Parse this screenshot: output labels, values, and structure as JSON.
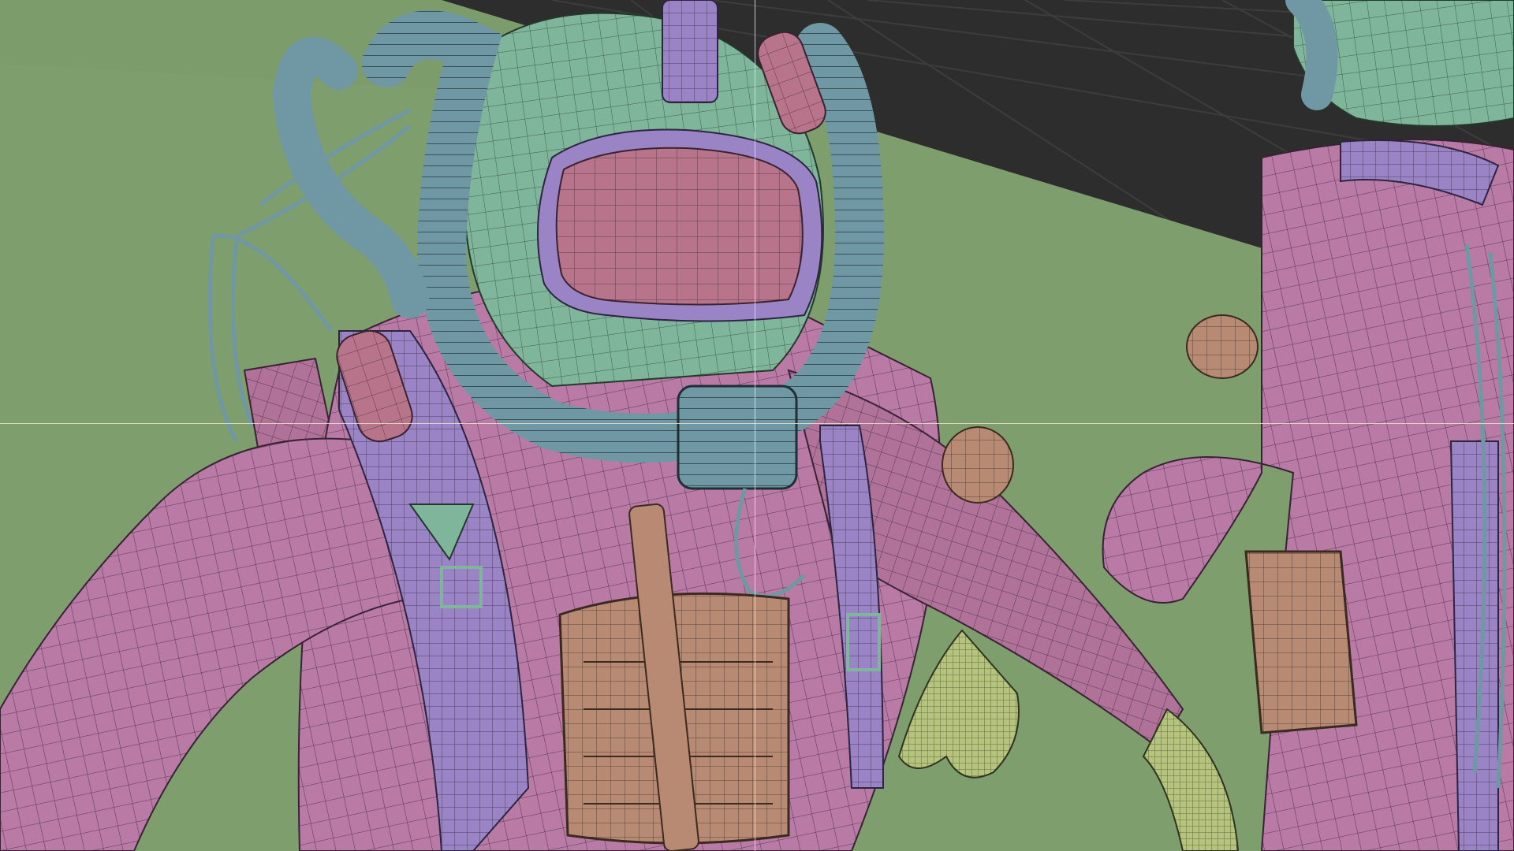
{
  "viewport": {
    "mode": "wireframe-overlay",
    "colors": {
      "background_dark": "#2d2d2d",
      "grid_line": "#3c3c3c",
      "ground": "#7f9e6e",
      "suit_pink": "#b97aa6",
      "strap_purple": "#9b84c6",
      "helmet_green": "#7fb59a",
      "hose_teal": "#6f97a4",
      "visor_pink": "#b7748a",
      "pouch_tan": "#b98a73",
      "glove_yellow": "#b4c47a",
      "wire": "#2a1f2a",
      "crosshair": "#ebe1cd"
    }
  },
  "scene": {
    "objects": [
      "diver-character-main",
      "diver-character-secondary",
      "helmet",
      "visor",
      "breathing-hose",
      "harness-straps",
      "chest-pouch",
      "gloves",
      "backpack-frame"
    ]
  }
}
